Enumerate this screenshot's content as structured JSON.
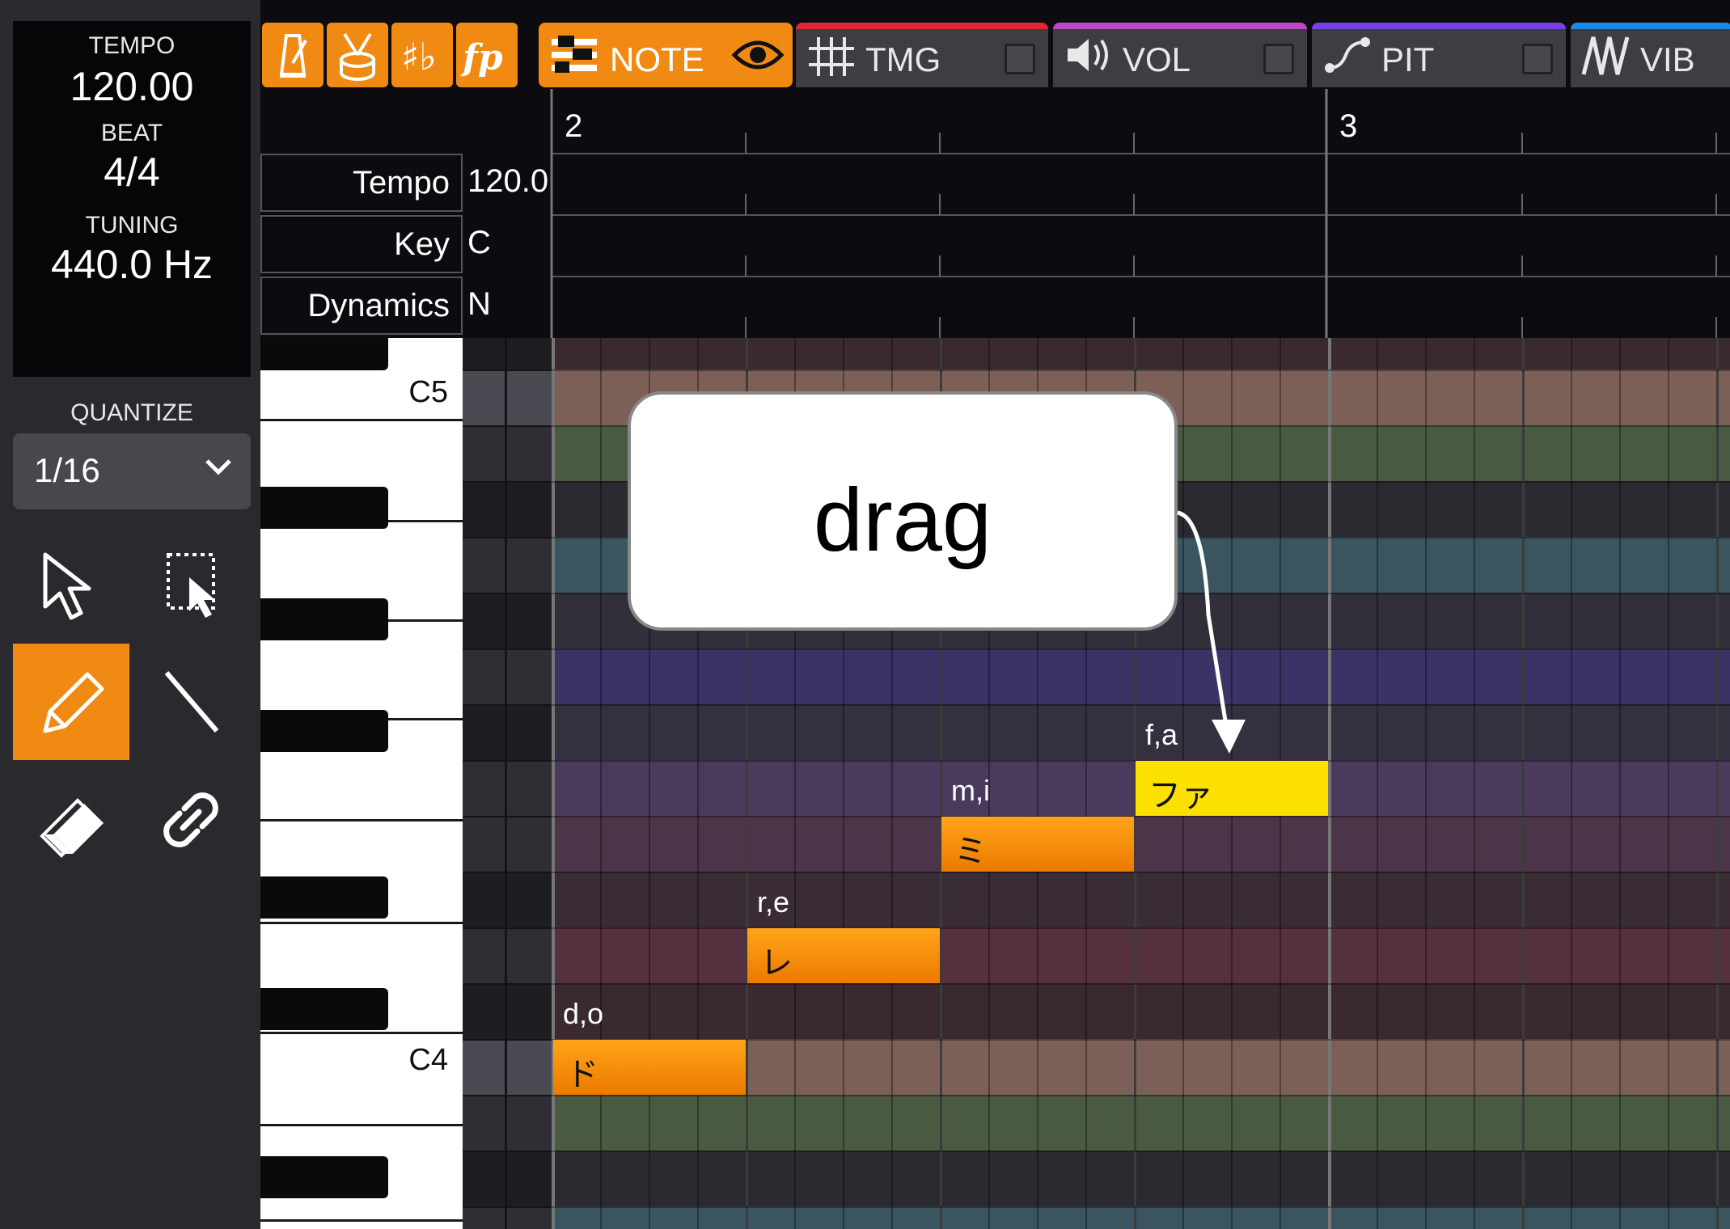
{
  "sidebar": {
    "tempo_label": "TEMPO",
    "tempo_value": "120.00",
    "beat_label": "BEAT",
    "beat_value": "4/4",
    "tuning_label": "TUNING",
    "tuning_value": "440.0 Hz",
    "quantize_label": "QUANTIZE",
    "quantize_value": "1/16",
    "tools": [
      "pointer-icon",
      "range-select-icon",
      "pencil-icon",
      "line-icon",
      "eraser-icon",
      "unlink-icon"
    ],
    "active_tool": "pencil-icon"
  },
  "toolbar": {
    "toggles": [
      "metronome-icon",
      "drum-icon",
      "key-signature-icon",
      "dynamics-icon"
    ],
    "tabs": [
      {
        "label": "NOTE",
        "icon": "piano-roll-icon",
        "active": true
      },
      {
        "label": "TMG",
        "icon": "timing-icon",
        "accent": "#e0263a"
      },
      {
        "label": "VOL",
        "icon": "volume-icon",
        "accent": "#c048c8"
      },
      {
        "label": "PIT",
        "icon": "pitch-icon",
        "accent": "#7a40e8"
      },
      {
        "label": "VIB",
        "icon": "vibrato-icon",
        "accent": "#1e88e8"
      }
    ]
  },
  "ruler": {
    "bars": [
      "2",
      "3"
    ]
  },
  "header_rows": [
    {
      "label": "Tempo",
      "value": "120.0"
    },
    {
      "label": "Key",
      "value": "C"
    },
    {
      "label": "Dynamics",
      "value": "N"
    }
  ],
  "keyboard": {
    "labels": [
      "C5",
      "C4"
    ]
  },
  "notes": [
    {
      "lyric": "d,o",
      "text": "ド",
      "selected": false
    },
    {
      "lyric": "r,e",
      "text": "レ",
      "selected": false
    },
    {
      "lyric": "m,i",
      "text": "ミ",
      "selected": false
    },
    {
      "lyric": "f,a",
      "text": "ファ",
      "selected": true
    }
  ],
  "callout": {
    "text": "drag"
  },
  "colors": {
    "accent": "#f08a12",
    "note": "#f7930e",
    "note_selected": "#fbe000",
    "row_c": "#7c6058",
    "row_b": "#495a40",
    "row_bb": "#2b2a30",
    "row_a": "#3a5560",
    "row_ab": "#322f3a",
    "row_g": "#3a3466",
    "row_fs": "#35303f",
    "row_f": "#4a3a5e",
    "row_e": "#4c3548",
    "row_eb": "#3a2c34",
    "row_d": "#55303e",
    "row_cs": "#3a2a30"
  }
}
